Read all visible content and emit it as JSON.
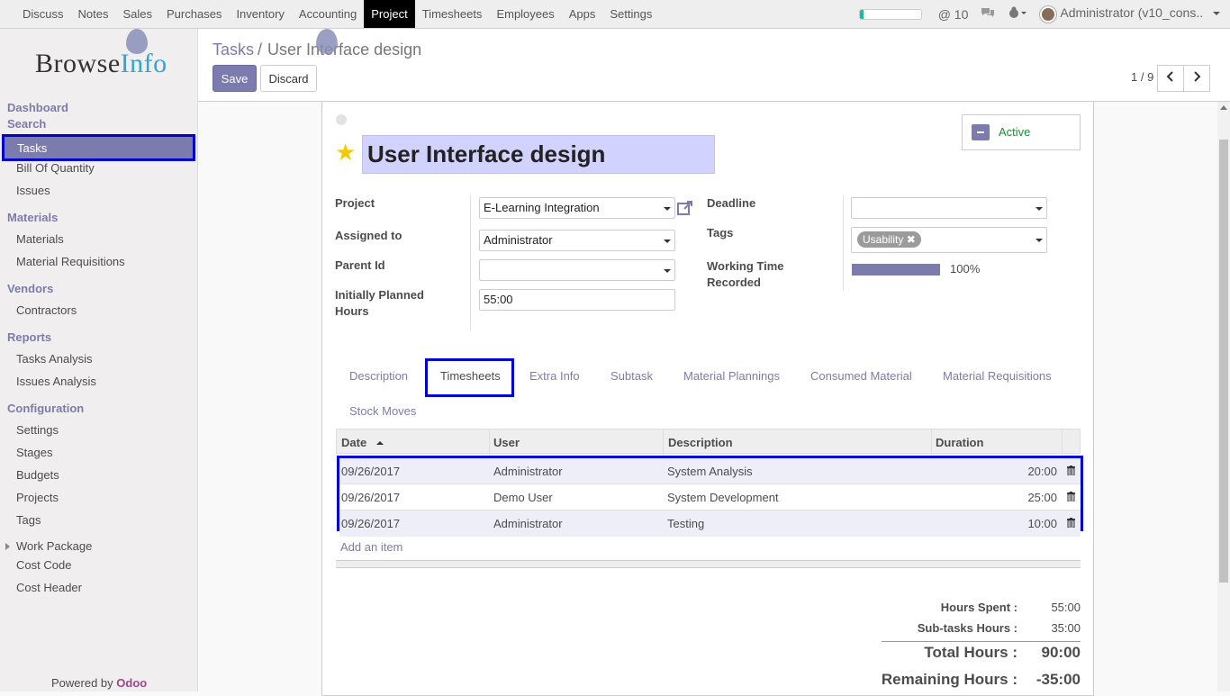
{
  "topbar": {
    "menu": [
      "Discuss",
      "Notes",
      "Sales",
      "Purchases",
      "Inventory",
      "Accounting",
      "Project",
      "Timesheets",
      "Employees",
      "Apps",
      "Settings"
    ],
    "active_menu": "Project",
    "messages_count": "@ 10",
    "user_label": "Administrator (v10_cons.."
  },
  "sidebar": {
    "logo_main": "Browse",
    "logo_accent": "Info",
    "dashboard": "Dashboard",
    "search": "Search",
    "tasks": "Tasks",
    "bill_of_quantity": "Bill Of Quantity",
    "issues": "Issues",
    "materials_section": "Materials",
    "materials": "Materials",
    "material_requisitions": "Material Requisitions",
    "vendors_section": "Vendors",
    "contractors": "Contractors",
    "reports_section": "Reports",
    "tasks_analysis": "Tasks Analysis",
    "issues_analysis": "Issues Analysis",
    "configuration_section": "Configuration",
    "settings": "Settings",
    "stages": "Stages",
    "budgets": "Budgets",
    "projects": "Projects",
    "tags": "Tags",
    "work_package": "Work Package",
    "cost_code": "Cost Code",
    "cost_header": "Cost Header",
    "powered_prefix": "Powered by",
    "powered_brand": "Odoo"
  },
  "control_panel": {
    "breadcrumb_parent": "Tasks",
    "breadcrumb_sep": "/",
    "breadcrumb_current": "User Interface design",
    "save_label": "Save",
    "discard_label": "Discard",
    "pager": "1 / 9"
  },
  "form": {
    "active_label": "Active",
    "title": "User Interface design",
    "project_label": "Project",
    "project_value": "E-Learning Integration",
    "assigned_label": "Assigned to",
    "assigned_value": "Administrator",
    "parent_label": "Parent Id",
    "parent_value": "",
    "planned_label": "Initially Planned Hours",
    "planned_value": "55:00",
    "deadline_label": "Deadline",
    "deadline_value": "",
    "tags_label": "Tags",
    "tag": "Usability",
    "working_label": "Working Time Recorded",
    "working_pct": "100%",
    "working_progress": 1.0
  },
  "tabs": {
    "description": "Description",
    "timesheets": "Timesheets",
    "extra_info": "Extra Info",
    "subtask": "Subtask",
    "material_plannings": "Material Plannings",
    "consumed_material": "Consumed Material",
    "material_requisitions": "Material Requisitions",
    "stock_moves": "Stock Moves"
  },
  "timesheet_table": {
    "headers": {
      "date": "Date",
      "user": "User",
      "description": "Description",
      "duration": "Duration"
    },
    "rows": [
      {
        "date": "09/26/2017",
        "user": "Administrator",
        "description": "System Analysis",
        "duration": "20:00"
      },
      {
        "date": "09/26/2017",
        "user": "Demo User",
        "description": "System Development",
        "duration": "25:00"
      },
      {
        "date": "09/26/2017",
        "user": "Administrator",
        "description": "Testing",
        "duration": "10:00"
      }
    ],
    "add_item": "Add an item"
  },
  "totals": {
    "hours_spent_label": "Hours Spent :",
    "hours_spent": "55:00",
    "subtask_label": "Sub-tasks Hours :",
    "subtask_hours": "35:00",
    "total_label": "Total Hours :",
    "total_hours": "90:00",
    "remaining_label": "Remaining Hours :",
    "remaining_hours": "-35:00"
  }
}
